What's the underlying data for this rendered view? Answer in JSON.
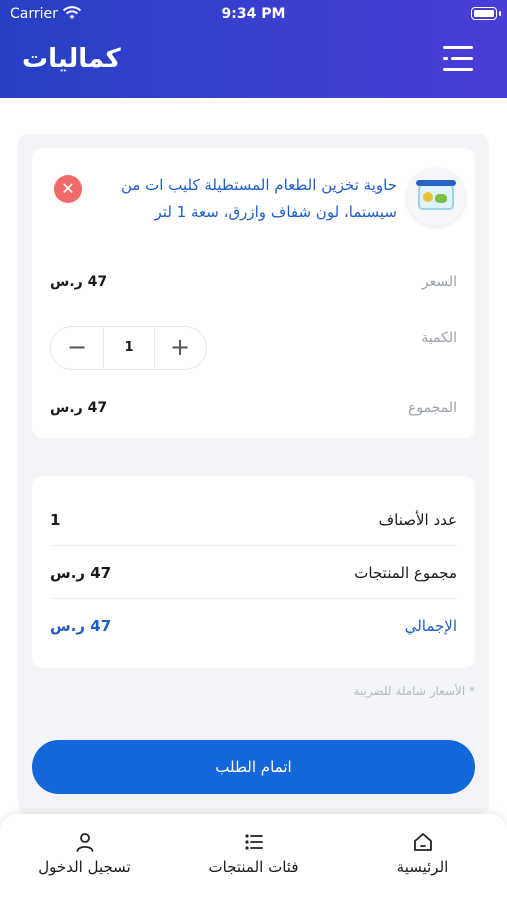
{
  "status_bar": {
    "carrier": "Carrier",
    "time": "9:34 PM"
  },
  "header": {
    "app_title": "كماليات",
    "menu_icon": "menu-icon"
  },
  "cart_item": {
    "name": "حاوية تخزين الطعام المستطيلة كليب ات من سيستما، لون شفاف وازرق، سعة 1 لتر",
    "price_label": "السعر",
    "price_value": "47 ر.س",
    "quantity_label": "الكمية",
    "quantity": "1",
    "subtotal_label": "المجموع",
    "subtotal_value": "47 ر.س",
    "remove_icon": "close-icon"
  },
  "summary": {
    "items_count_label": "عدد الأصناف",
    "items_count_value": "1",
    "products_total_label": "مجموع المنتجات",
    "products_total_value": "47 ر.س",
    "grand_total_label": "الإجمالي",
    "grand_total_value": "47 ر.س"
  },
  "tax_note": "* الأسعار شاملة للضريبة",
  "checkout_label": "اتمام الطلب",
  "bottom_nav": {
    "home": "الرئيسية",
    "categories": "فئات المنتجات",
    "login": "تسجيل الدخول"
  },
  "colors": {
    "primary": "#1466dc",
    "header": "#2d41c9",
    "remove": "#f26b6b",
    "link": "#1f5ec9"
  }
}
